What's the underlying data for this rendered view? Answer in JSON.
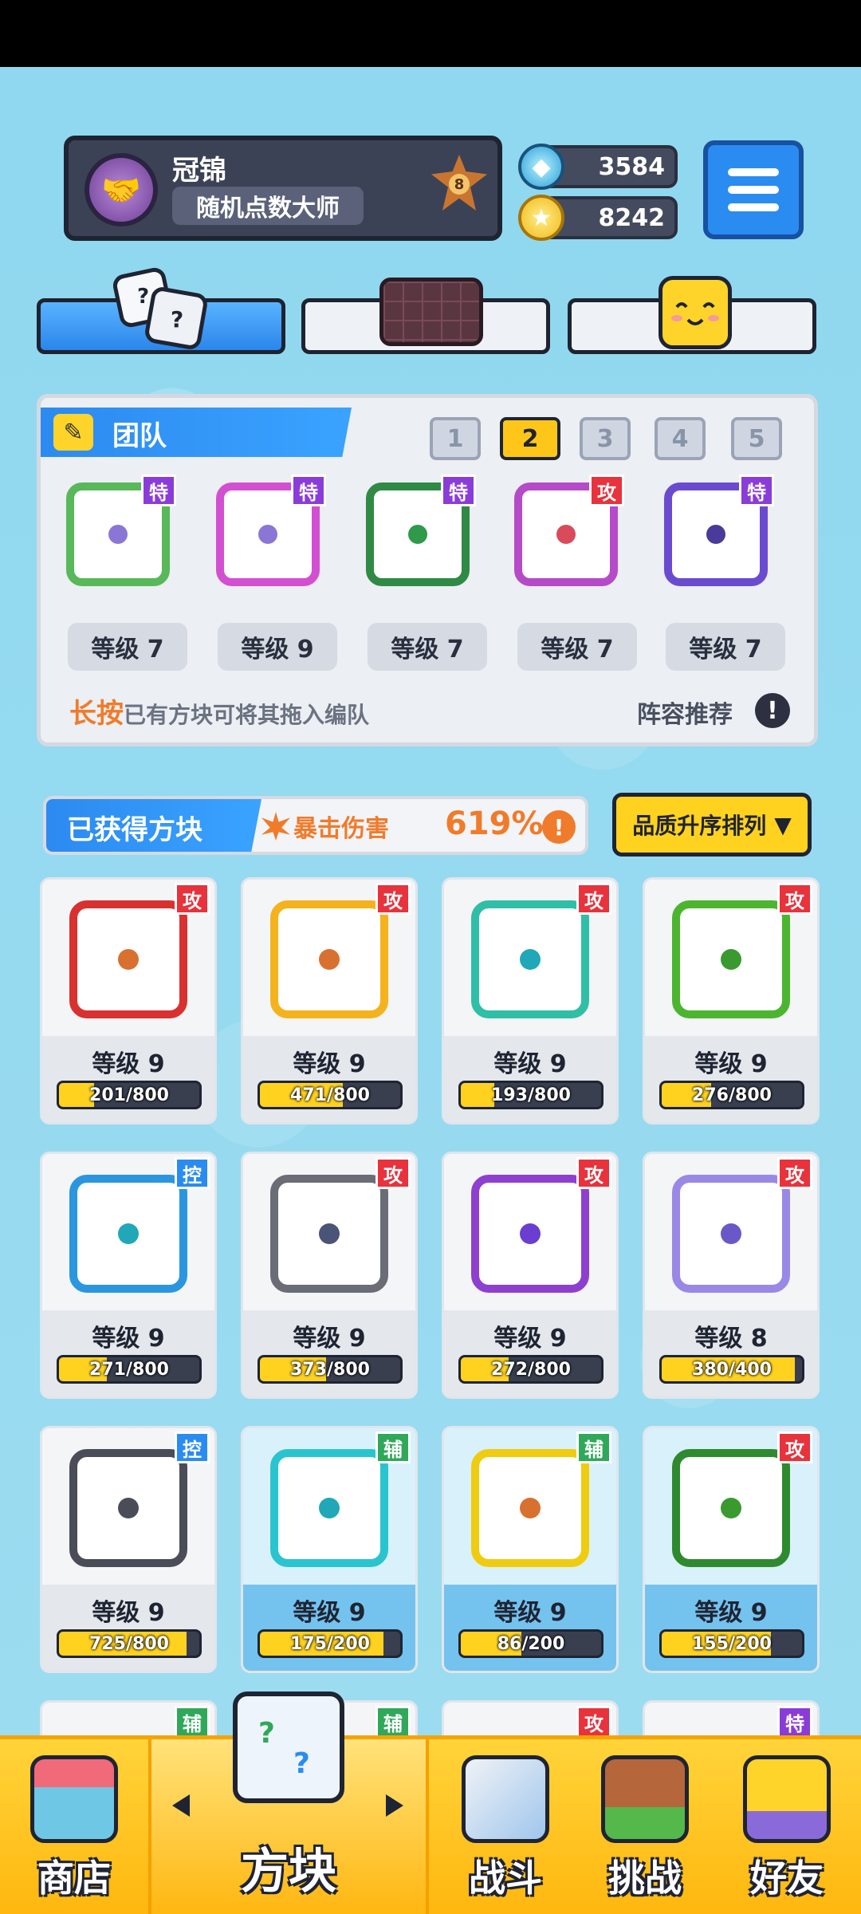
{
  "profile": {
    "name": "冠锦",
    "title": "随机点数大师",
    "rank": "8"
  },
  "currency": {
    "gems": "3584",
    "coins": "8242"
  },
  "tabs": [
    "dice-tab",
    "board-tab",
    "emoji-tab"
  ],
  "team": {
    "header": "团队",
    "slots": [
      "1",
      "2",
      "3",
      "4",
      "5"
    ],
    "active_slot": "2",
    "cards": [
      {
        "tag": "特",
        "level": "等级 7",
        "frame": "#58b85a",
        "dot": "#8b76d6",
        "tag_type": "spc"
      },
      {
        "tag": "特",
        "level": "等级 9",
        "frame": "#d34fd2",
        "dot": "#8b76d6",
        "tag_type": "spc"
      },
      {
        "tag": "特",
        "level": "等级 7",
        "frame": "#2f8a45",
        "dot": "#2f9a4a",
        "tag_type": "spc"
      },
      {
        "tag": "攻",
        "level": "等级 7",
        "frame": "#b54bc8",
        "dot": "#d94a5a",
        "tag_type": "atk"
      },
      {
        "tag": "特",
        "level": "等级 7",
        "frame": "#6a4bd0",
        "dot": "#4a3a9a",
        "tag_type": "spc"
      }
    ],
    "hint_strong": "长按",
    "hint_text": "已有方块可将其拖入编队",
    "lineup": "阵容推荐",
    "info": "!"
  },
  "obtained": {
    "label": "已获得方块",
    "crit_label": "暴击伤害",
    "crit_value": "619%",
    "alert": "!"
  },
  "sort": {
    "label": "品质升序排列",
    "arrow": "▼"
  },
  "dice": [
    {
      "tag": "攻",
      "tag_type": "atk",
      "level": "等级 9",
      "progress": "201/800",
      "fill": 0.25,
      "frame": "#d8312f",
      "dot": "#d8712f",
      "bg": "plain"
    },
    {
      "tag": "攻",
      "tag_type": "atk",
      "level": "等级 9",
      "progress": "471/800",
      "fill": 0.59,
      "frame": "#f4b31c",
      "dot": "#d8712f",
      "bg": "plain"
    },
    {
      "tag": "攻",
      "tag_type": "atk",
      "level": "等级 9",
      "progress": "193/800",
      "fill": 0.24,
      "frame": "#2fbfa6",
      "dot": "#20a8b8",
      "bg": "plain"
    },
    {
      "tag": "攻",
      "tag_type": "atk",
      "level": "等级 9",
      "progress": "276/800",
      "fill": 0.35,
      "frame": "#4cb52f",
      "dot": "#3a9a30",
      "bg": "plain"
    },
    {
      "tag": "控",
      "tag_type": "ctl",
      "level": "等级 9",
      "progress": "271/800",
      "fill": 0.34,
      "frame": "#2a96e0",
      "dot": "#20a8b8",
      "bg": "plain"
    },
    {
      "tag": "攻",
      "tag_type": "atk",
      "level": "等级 9",
      "progress": "373/800",
      "fill": 0.47,
      "frame": "#6a6d76",
      "dot": "#4a5478",
      "bg": "plain"
    },
    {
      "tag": "攻",
      "tag_type": "atk",
      "level": "等级 9",
      "progress": "272/800",
      "fill": 0.34,
      "frame": "#8e3fd0",
      "dot": "#6a3ed0",
      "bg": "plain"
    },
    {
      "tag": "攻",
      "tag_type": "atk",
      "level": "等级 8",
      "progress": "380/400",
      "fill": 0.95,
      "frame": "#9a88e6",
      "dot": "#6a58c8",
      "bg": "plain"
    },
    {
      "tag": "控",
      "tag_type": "ctl",
      "level": "等级 9",
      "progress": "725/800",
      "fill": 0.91,
      "frame": "#4a4d58",
      "dot": "#4a4d58",
      "bg": "plain"
    },
    {
      "tag": "辅",
      "tag_type": "sup",
      "level": "等级 9",
      "progress": "175/200",
      "fill": 0.88,
      "frame": "#2ac4cf",
      "dot": "#20a8b8",
      "bg": "blue"
    },
    {
      "tag": "辅",
      "tag_type": "sup",
      "level": "等级 9",
      "progress": "86/200",
      "fill": 0.43,
      "frame": "#f0cc10",
      "dot": "#d8712f",
      "bg": "blue"
    },
    {
      "tag": "攻",
      "tag_type": "atk",
      "level": "等级 9",
      "progress": "155/200",
      "fill": 0.78,
      "frame": "#2f8a2f",
      "dot": "#3a9a30",
      "bg": "blue"
    }
  ],
  "partial_tags": [
    {
      "tag": "辅",
      "tag_type": "sup"
    },
    {
      "tag": "辅",
      "tag_type": "sup"
    },
    {
      "tag": "攻",
      "tag_type": "atk"
    },
    {
      "tag": "特",
      "tag_type": "spc"
    }
  ],
  "nav": {
    "shop": "商店",
    "dice": "方块",
    "battle": "战斗",
    "challenge": "挑战",
    "friends": "好友"
  }
}
